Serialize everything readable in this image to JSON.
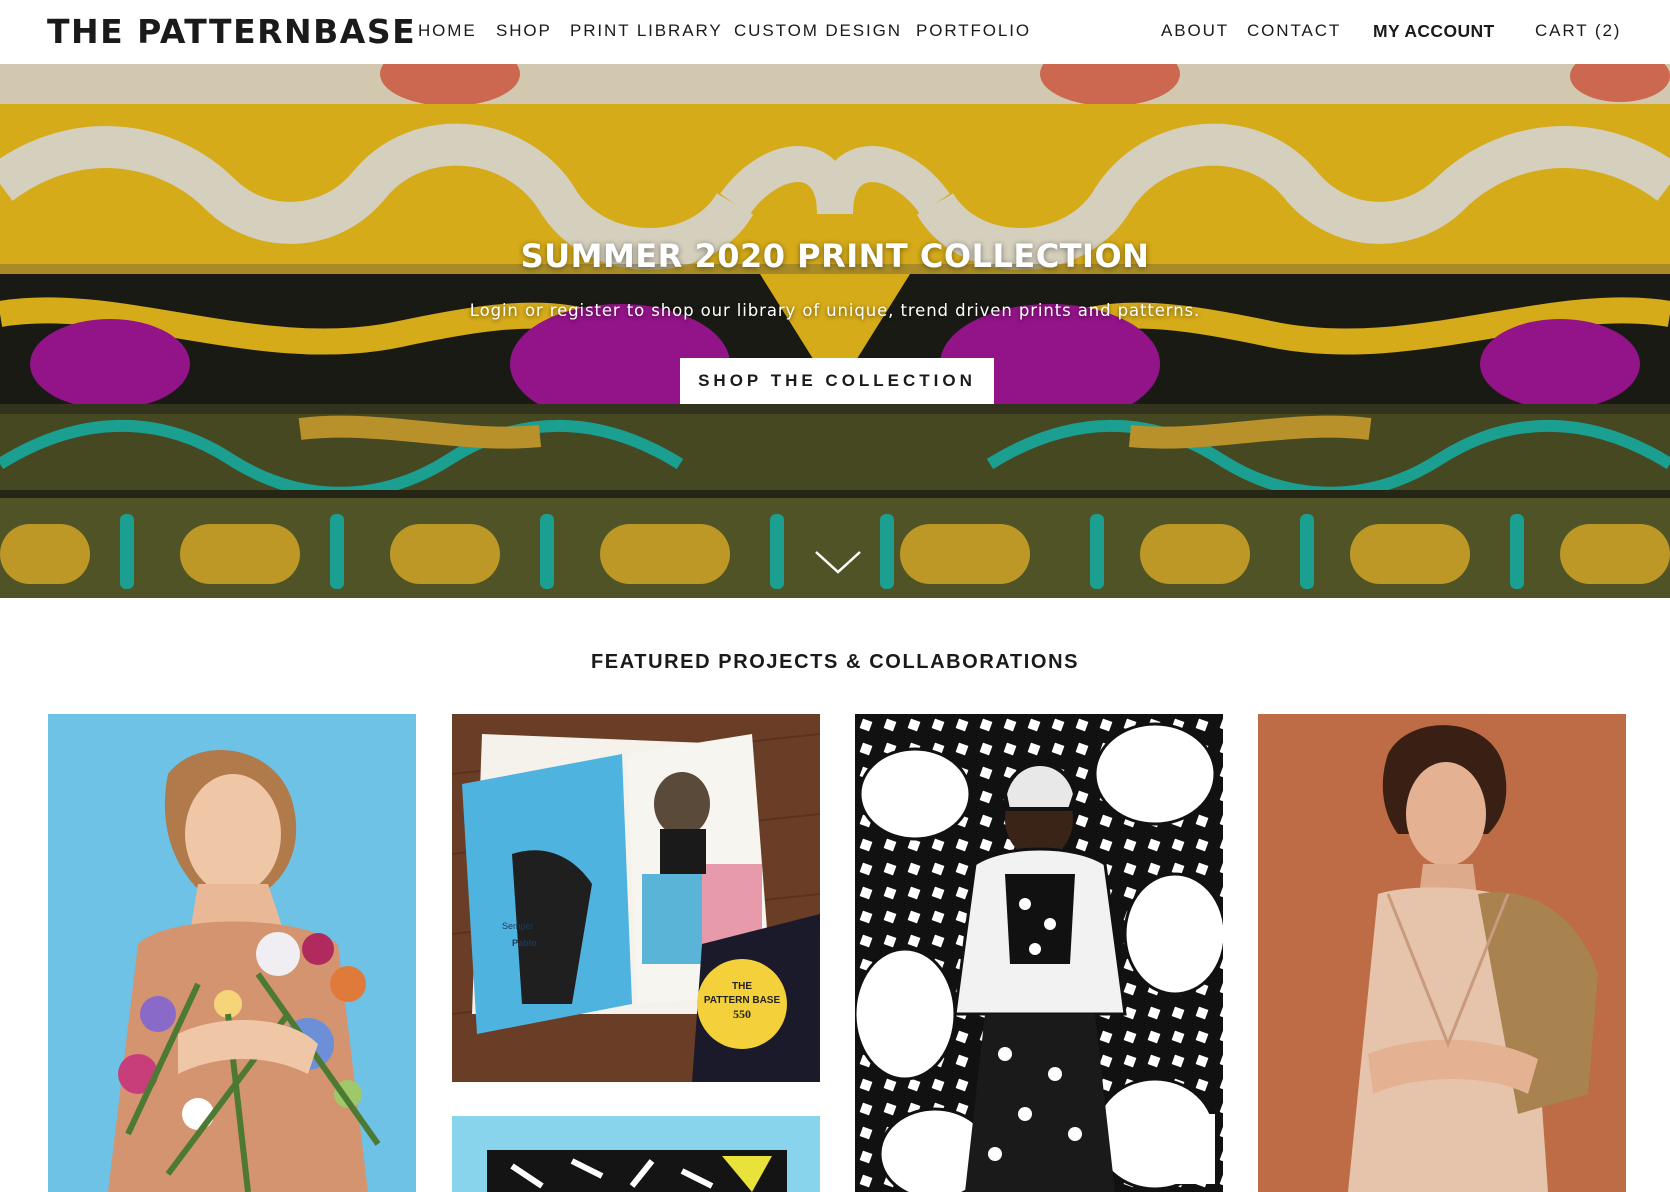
{
  "header": {
    "logo": "THE PATTERNBASE",
    "nav_left": [
      "HOME",
      "SHOP",
      "PRINT LIBRARY",
      "CUSTOM DESIGN",
      "PORTFOLIO"
    ],
    "nav_right": {
      "about": "ABOUT",
      "contact": "CONTACT",
      "account": "MY ACCOUNT",
      "cart": "CART (2)"
    }
  },
  "hero": {
    "title": "SUMMER 2020 PRINT COLLECTION",
    "subtitle": "Login or register to shop our library of unique, trend driven prints and patterns.",
    "cta": "SHOP THE COLLECTION",
    "scroll_icon": "chevron-down-icon"
  },
  "featured": {
    "title": "FEATURED PROJECTS & COLLABORATIONS",
    "book": {
      "badge_line1": "THE",
      "badge_line2": "PATTERN BASE",
      "badge_line3": "550",
      "caption_left": "Semper",
      "caption_left2": "Pablo"
    }
  },
  "colors": {
    "yellow": "#f2c12e",
    "magenta": "#a8169b",
    "olive": "#5a5a24",
    "teal": "#19b3a6",
    "sky": "#6ec2e6",
    "terracotta": "#b9643e"
  }
}
